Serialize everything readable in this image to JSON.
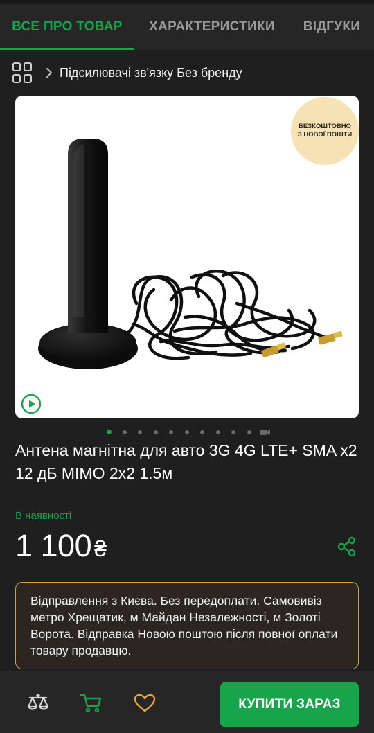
{
  "tabs": [
    {
      "label": "ВСЕ ПРО ТОВАР",
      "active": true
    },
    {
      "label": "ХАРАКТЕРИСТИКИ",
      "active": false
    },
    {
      "label": "ВІДГУКИ",
      "active": false
    }
  ],
  "breadcrumb": {
    "category": "Підсилювачі зв'язку Без бренду",
    "icons": [
      "grid-icon",
      "chevron-right-icon"
    ]
  },
  "product": {
    "promo_badge": [
      "БЕЗКОШТОВНО",
      "З НОВОЇ ПОШТИ"
    ],
    "image_count": 10,
    "active_image": 1,
    "title": "Антена магнітна для авто 3G 4G LTE+ SMA x2 12 дБ MIMO 2x2 1.5м",
    "stock": "В наявності",
    "price": "1 100",
    "currency": "₴",
    "seller_note": "Відправлення з Києва. Без передоплати. Самовивіз метро Хрещатик, м Майдан Незалежності, м Золоті Ворота. Відправка Новою поштою після повної оплати товару продавцю."
  },
  "bottom_bar": {
    "icons": [
      "compare-icon",
      "cart-icon",
      "heart-icon"
    ],
    "buy_label": "КУПИТИ ЗАРАЗ"
  },
  "colors": {
    "accent": "#17a44a",
    "background": "#1f1f1f",
    "note_border": "#d99a3e",
    "promo": "#f7e2b5"
  }
}
